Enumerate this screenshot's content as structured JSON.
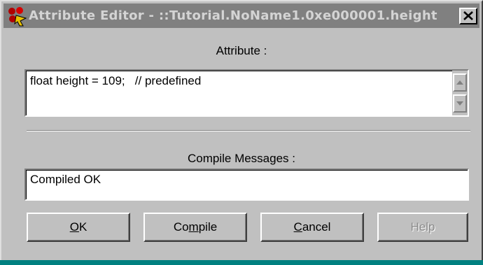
{
  "window": {
    "title": "Attribute Editor - ::Tutorial.NoName1.0xe000001.height",
    "close_symbol": "✕"
  },
  "attribute_section": {
    "label": "Attribute :",
    "value": "float height = 109;   // predefined"
  },
  "compile_section": {
    "label": "Compile Messages :",
    "value": "Compiled OK"
  },
  "buttons": {
    "ok": {
      "accel": "O",
      "rest": "K"
    },
    "compile": {
      "pre": "Co",
      "accel": "m",
      "rest": "pile"
    },
    "cancel": {
      "accel": "C",
      "rest": "ancel"
    },
    "help": {
      "label": "Help",
      "enabled": false
    }
  },
  "icons": [
    "app-icon",
    "close-icon",
    "scroll-up-icon",
    "scroll-down-icon"
  ],
  "colors": {
    "titlebar_inactive": "#808080",
    "face": "#c0c0c0",
    "disabled_text": "#8a8a8a"
  }
}
